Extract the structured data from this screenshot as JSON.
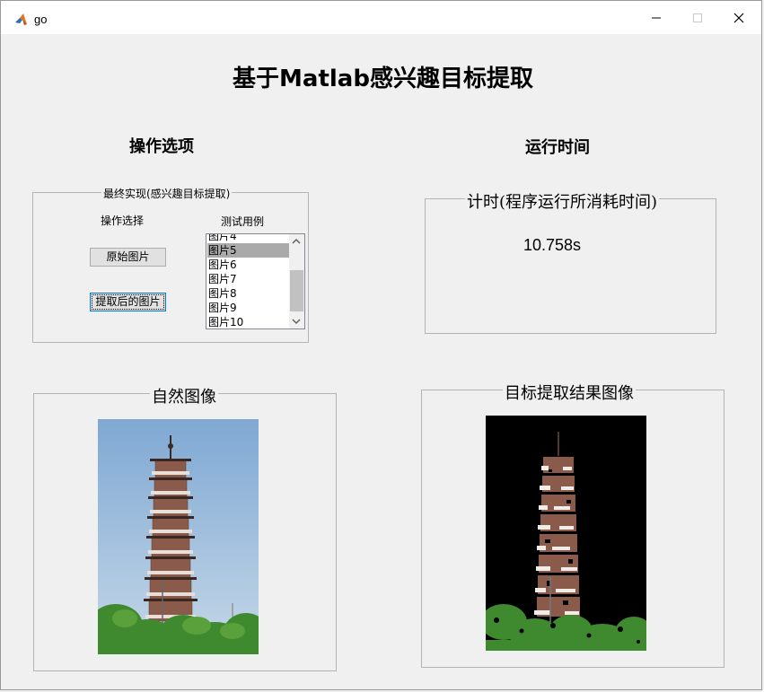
{
  "window": {
    "title": "go"
  },
  "main_title": "基于Matlab感兴趣目标提取",
  "ops_section_title": "操作选项",
  "time_section_title": "运行时间",
  "ops_panel": {
    "legend": "最终实现(感兴趣目标提取)",
    "op_label": "操作选择",
    "test_label": "测试用例",
    "btn_original": "原始图片",
    "btn_extracted": "提取后的图片"
  },
  "list": {
    "items": [
      "图片4",
      "图片5",
      "图片6",
      "图片7",
      "图片8",
      "图片9",
      "图片10"
    ],
    "selected": "图片5"
  },
  "timer_panel": {
    "legend": "计时(程序运行所消耗时间)",
    "value": "10.758s"
  },
  "natural_panel": {
    "legend": "自然图像"
  },
  "result_panel": {
    "legend": "目标提取结果图像"
  },
  "colors": {
    "sky": "#8fb4d8",
    "tower": "#8a5a4a",
    "tree": "#3f8a2e",
    "black": "#000000"
  }
}
